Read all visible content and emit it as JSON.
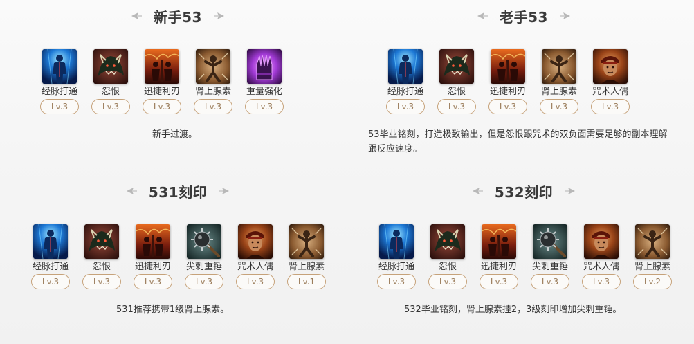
{
  "sections": [
    {
      "title": "新手53",
      "skills": [
        {
          "name": "经脉打通",
          "level": "Lv.3",
          "icon": "meridian-icon"
        },
        {
          "name": "怨恨",
          "level": "Lv.3",
          "icon": "grudge-icon"
        },
        {
          "name": "迅捷利刃",
          "level": "Lv.3",
          "icon": "swift-blade-icon"
        },
        {
          "name": "肾上腺素",
          "level": "Lv.3",
          "icon": "adrenaline-icon"
        },
        {
          "name": "重量强化",
          "level": "Lv.3",
          "icon": "weight-boost-icon"
        }
      ],
      "description": "新手过渡。"
    },
    {
      "title": "老手53",
      "skills": [
        {
          "name": "经脉打通",
          "level": "Lv.3",
          "icon": "meridian-icon"
        },
        {
          "name": "怨恨",
          "level": "Lv.3",
          "icon": "grudge-icon"
        },
        {
          "name": "迅捷利刃",
          "level": "Lv.3",
          "icon": "swift-blade-icon"
        },
        {
          "name": "肾上腺素",
          "level": "Lv.3",
          "icon": "adrenaline-icon"
        },
        {
          "name": "咒术人偶",
          "level": "Lv.3",
          "icon": "curse-doll-icon"
        }
      ],
      "description": "53毕业铭刻，打造极致输出，但是怨恨跟咒术的双负面需要足够的副本理解跟反应速度。"
    },
    {
      "title": "531刻印",
      "skills": [
        {
          "name": "经脉打通",
          "level": "Lv.3",
          "icon": "meridian-icon"
        },
        {
          "name": "怨恨",
          "level": "Lv.3",
          "icon": "grudge-icon"
        },
        {
          "name": "迅捷利刃",
          "level": "Lv.3",
          "icon": "swift-blade-icon"
        },
        {
          "name": "尖刺重锤",
          "level": "Lv.3",
          "icon": "spiked-hammer-icon"
        },
        {
          "name": "咒术人偶",
          "level": "Lv.3",
          "icon": "curse-doll-icon"
        },
        {
          "name": "肾上腺素",
          "level": "Lv.1",
          "icon": "adrenaline-icon"
        }
      ],
      "description": "531推荐携带1级肾上腺素。"
    },
    {
      "title": "532刻印",
      "skills": [
        {
          "name": "经脉打通",
          "level": "Lv.3",
          "icon": "meridian-icon"
        },
        {
          "name": "怨恨",
          "level": "Lv.3",
          "icon": "grudge-icon"
        },
        {
          "name": "迅捷利刃",
          "level": "Lv.3",
          "icon": "swift-blade-icon"
        },
        {
          "name": "尖刺重锤",
          "level": "Lv.3",
          "icon": "spiked-hammer-icon"
        },
        {
          "name": "咒术人偶",
          "level": "Lv.3",
          "icon": "curse-doll-icon"
        },
        {
          "name": "肾上腺素",
          "level": "Lv.2",
          "icon": "adrenaline-icon"
        }
      ],
      "description": "532毕业铭刻，肾上腺素挂2，3级刻印增加尖刺重锤。"
    }
  ]
}
